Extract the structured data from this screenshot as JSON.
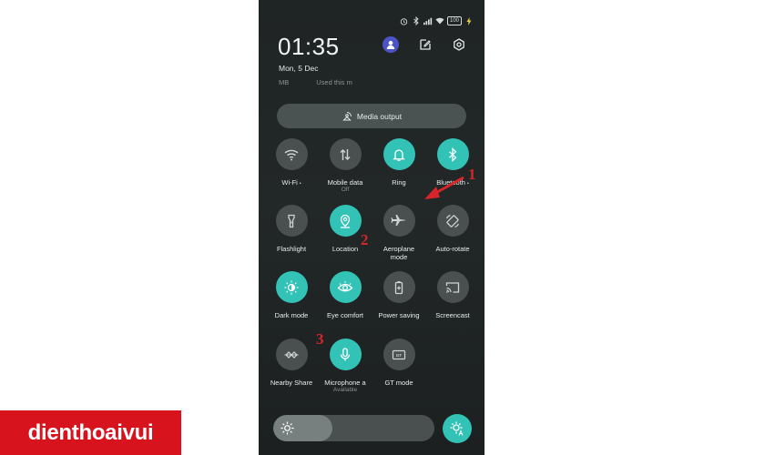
{
  "status_bar": {
    "battery": "100"
  },
  "header": {
    "time": "01:35",
    "date": "Mon, 5 Dec",
    "data_usage": [
      "MB",
      "Used this m"
    ]
  },
  "media_output": {
    "label": "Media output"
  },
  "tiles": [
    {
      "label": "Wi-Fi",
      "caret": "•",
      "sub": "",
      "active": false,
      "icon": "wifi-icon"
    },
    {
      "label": "Mobile data",
      "caret": "",
      "sub": "Off",
      "active": false,
      "icon": "mobile-data-icon"
    },
    {
      "label": "Ring",
      "caret": "",
      "sub": "",
      "active": true,
      "icon": "bell-icon"
    },
    {
      "label": "Bluetooth",
      "caret": "•",
      "sub": "",
      "active": true,
      "icon": "bluetooth-icon"
    },
    {
      "label": "Flashlight",
      "caret": "",
      "sub": "",
      "active": false,
      "icon": "flashlight-icon"
    },
    {
      "label": "Location",
      "caret": "",
      "sub": "",
      "active": true,
      "icon": "location-icon"
    },
    {
      "label": "Aeroplane",
      "label2": "mode",
      "caret": "",
      "sub": "",
      "active": false,
      "icon": "airplane-icon"
    },
    {
      "label": "Auto-rotate",
      "caret": "",
      "sub": "",
      "active": false,
      "icon": "auto-rotate-icon"
    },
    {
      "label": "Dark mode",
      "caret": "",
      "sub": "",
      "active": true,
      "icon": "dark-mode-icon"
    },
    {
      "label": "Eye comfort",
      "caret": "",
      "sub": "",
      "active": true,
      "icon": "eye-icon"
    },
    {
      "label": "Power saving",
      "caret": "",
      "sub": "",
      "active": false,
      "icon": "battery-icon"
    },
    {
      "label": "Screencast",
      "caret": "",
      "sub": "",
      "active": false,
      "icon": "screencast-icon"
    },
    {
      "label": "Nearby Share",
      "caret": "",
      "sub": "",
      "active": false,
      "icon": "nearby-share-icon"
    },
    {
      "label": "Microphone a",
      "caret": "",
      "sub": "Available",
      "active": true,
      "icon": "microphone-icon"
    },
    {
      "label": "GT mode",
      "caret": "",
      "sub": "",
      "active": false,
      "icon": "gt-mode-icon"
    }
  ],
  "brightness": {
    "level": 0.37
  },
  "annotations": {
    "marker1": "1",
    "marker2": "2",
    "marker3": "3"
  },
  "logo": {
    "text": "dienthoaivui"
  },
  "colors": {
    "accent": "#33c2b6",
    "tile_off": "#4a5050",
    "panel": "#212626",
    "logo_bg": "#d7141e",
    "marker": "#d6262b"
  }
}
